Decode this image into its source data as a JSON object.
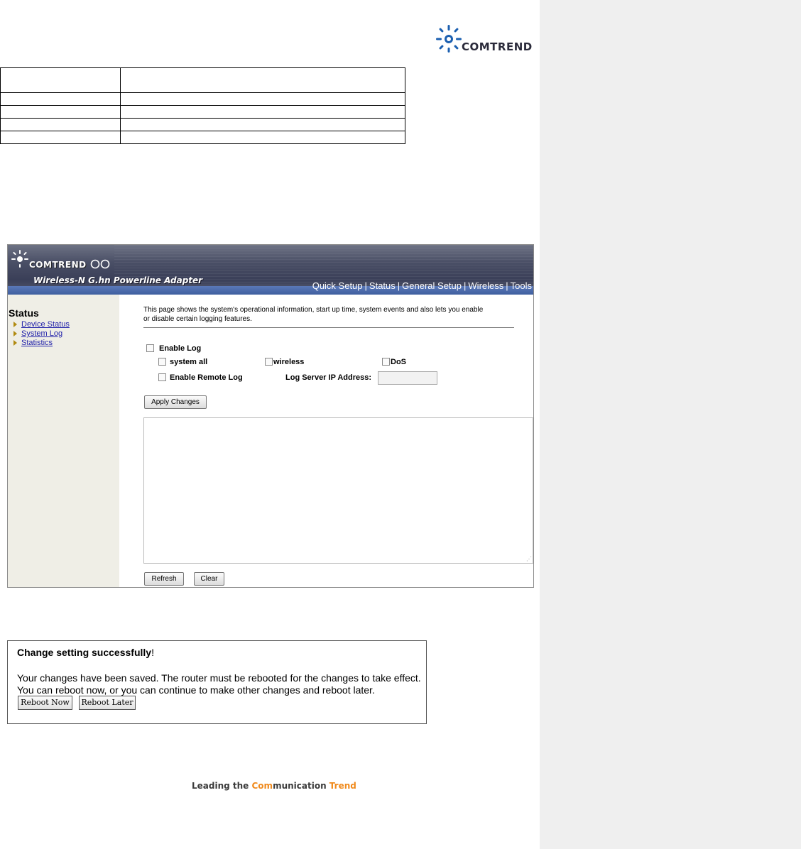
{
  "doc_header": {
    "logo_text": "COMTREND"
  },
  "table": {
    "rows": 5
  },
  "banner": {
    "brand": "COMTREND",
    "product": "Wireless-N G.hn Powerline Adapter",
    "nav": [
      "Quick Setup",
      "Status",
      "General Setup",
      "Wireless",
      "Tools"
    ],
    "separator": "|"
  },
  "sidebar": {
    "title": "Status",
    "items": [
      {
        "label": "Device Status"
      },
      {
        "label": "System Log"
      },
      {
        "label": "Statistics"
      }
    ]
  },
  "content": {
    "intro_line1": "This page shows the system's operational information, start up time, system events and also lets you enable",
    "intro_line2": "or disable certain logging features.",
    "enable_log": "Enable Log",
    "system_all": "system all",
    "wireless": "wireless",
    "dos": "DoS",
    "enable_remote_log": "Enable Remote Log",
    "log_server_label": "Log Server IP Address:",
    "log_server_value": "",
    "apply_button": "Apply Changes",
    "refresh_button": "Refresh",
    "clear_button": "Clear"
  },
  "message": {
    "title": "Change setting successfully",
    "title_mark": "!",
    "line1": "Your changes have been saved. The router must be rebooted for the changes to take effect.",
    "line2": "You can reboot now, or you can continue to make other changes and reboot later.",
    "reboot_now": "Reboot Now",
    "reboot_later": "Reboot Later"
  },
  "footer": {
    "part1": "Leading the ",
    "part2": "Com",
    "part3": "munication ",
    "part4": "Trend"
  },
  "colors": {
    "accent_orange": "#f08a1c",
    "banner_dark": "#3a3f58",
    "sidebar_bg": "#efeee6",
    "margin_bg": "#efefef"
  }
}
